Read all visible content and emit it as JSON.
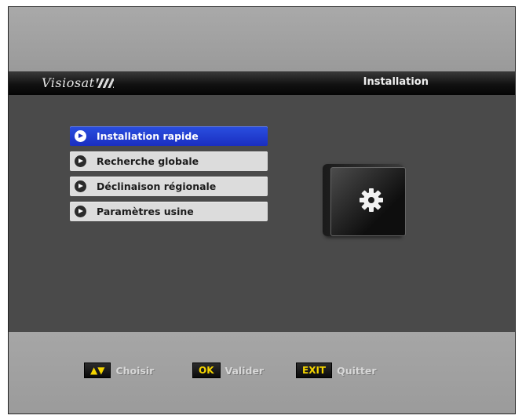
{
  "header": {
    "brand": "Visiosat",
    "title": "Installation"
  },
  "menu": {
    "items": [
      {
        "label": "Installation rapide",
        "selected": true
      },
      {
        "label": "Recherche globale",
        "selected": false
      },
      {
        "label": "Déclinaison régionale",
        "selected": false
      },
      {
        "label": "Paramètres usine",
        "selected": false
      }
    ]
  },
  "illustration": {
    "icon": "gear-folder-icon"
  },
  "footer": {
    "hints": [
      {
        "key": "▲▼",
        "label": "Choisir"
      },
      {
        "key": "OK",
        "label": "Valider"
      },
      {
        "key": "EXIT",
        "label": "Quitter"
      }
    ]
  },
  "colors": {
    "selected_item": "#1a2ec0",
    "item": "#dcdcdc",
    "key_text": "#f4d400",
    "background": "#4a4a4a"
  }
}
